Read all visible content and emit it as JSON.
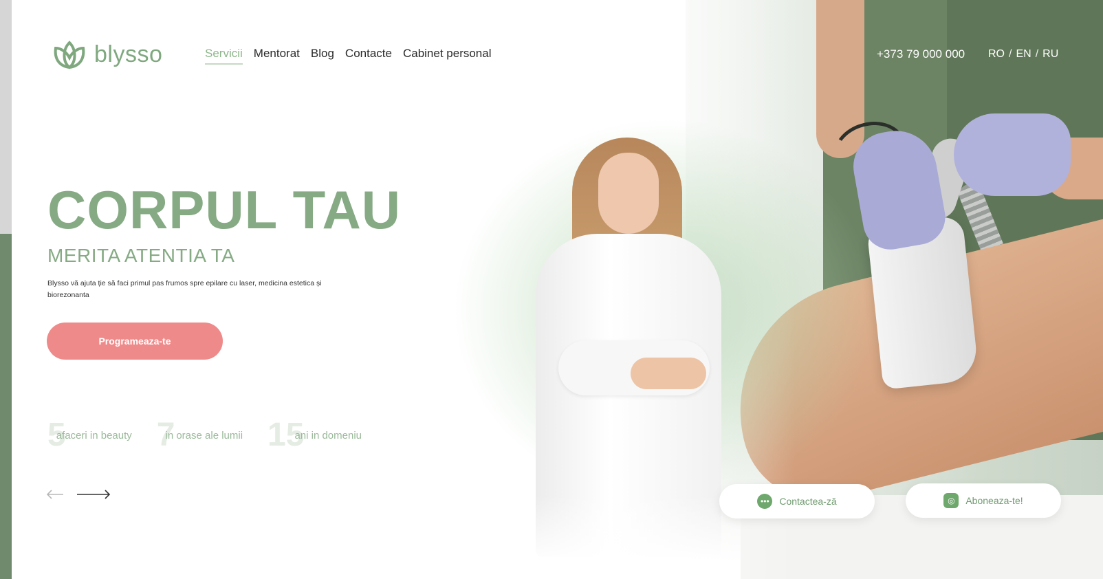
{
  "brand": {
    "name": "blysso",
    "color": "#7fa87f"
  },
  "nav": {
    "items": [
      {
        "label": "Servicii",
        "active": true
      },
      {
        "label": "Mentorat"
      },
      {
        "label": "Blog"
      },
      {
        "label": "Contacte"
      },
      {
        "label": "Cabinet personal"
      }
    ]
  },
  "header": {
    "phone": "+373 79 000 000",
    "languages": [
      "RO",
      "EN",
      "RU"
    ]
  },
  "hero": {
    "title": "CORPUL TAU",
    "subtitle": "MERITA ATENTIA TA",
    "description": "Blysso vă ajuta ție să faci primul pas frumos spre epilare cu laser, medicina estetica și biorezonanta",
    "cta_label": "Programeaza-te",
    "cta_color": "#ef8a8a"
  },
  "stats": [
    {
      "number": "5",
      "label": "afaceri in beauty"
    },
    {
      "number": "7",
      "label": "in orase ale lumii"
    },
    {
      "number": "15",
      "label": "ani in domeniu"
    }
  ],
  "carousel": {
    "prev_icon": "arrow-left-icon",
    "next_icon": "arrow-right-icon"
  },
  "actions": {
    "contact_label": "Contactea-ză",
    "contact_icon": "chat-icon",
    "subscribe_label": "Aboneaza-te!",
    "subscribe_icon": "instagram-icon"
  }
}
